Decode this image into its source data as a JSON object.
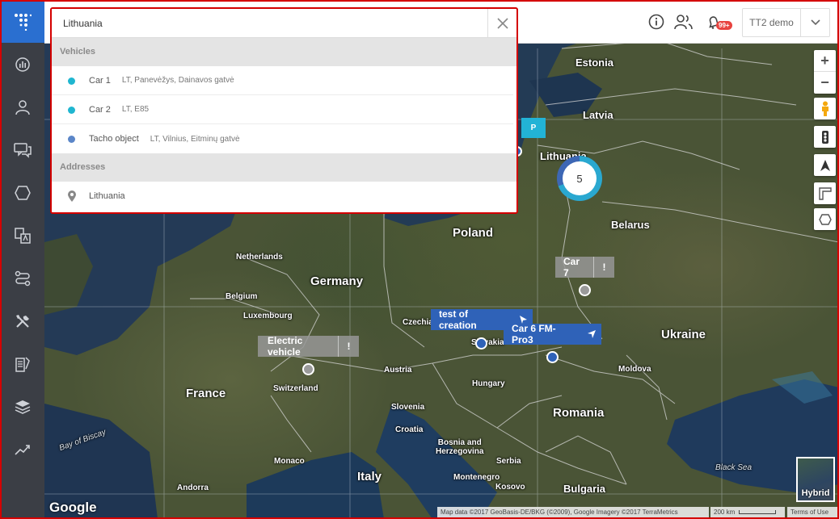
{
  "header": {
    "account_name": "TT2 demo",
    "notification_badge": "99+",
    "icons": [
      "info-icon",
      "users-icon",
      "notifications-icon"
    ]
  },
  "sidebar": {
    "items": [
      "logo",
      "dashboard-icon",
      "user-icon",
      "messages-icon",
      "geozones-icon",
      "reports-icon",
      "routes-icon",
      "tools-icon",
      "documents-icon",
      "layers-icon",
      "trends-icon"
    ]
  },
  "search": {
    "value": "Lithuania",
    "vehicles_header": "Vehicles",
    "vehicles": [
      {
        "name": "Car 1",
        "address": "LT, Panevėžys, Dainavos gatvė",
        "color": "#1fb6d0"
      },
      {
        "name": "Car 2",
        "address": "LT, E85",
        "color": "#1fb6d0"
      },
      {
        "name": "Tacho object",
        "address": "LT, Vilnius, Eitminų gatvė",
        "color": "#5b86c8"
      }
    ],
    "addresses_header": "Addresses",
    "addresses": [
      {
        "name": "Lithuania"
      }
    ]
  },
  "map": {
    "labels": {
      "estonia": "Estonia",
      "latvia": "Latvia",
      "lithuania": "Lithuania",
      "belarus": "Belarus",
      "poland": "Poland",
      "netherlands": "Netherlands",
      "germany": "Germany",
      "belgium": "Belgium",
      "luxembourg": "Luxembourg",
      "czechia": "Czechia",
      "slovakia": "Slovakia",
      "ukraine": "Ukraine",
      "austria": "Austria",
      "hungary": "Hungary",
      "moldova": "Moldova",
      "france": "France",
      "switzerland": "Switzerland",
      "slovenia": "Slovenia",
      "croatia": "Croatia",
      "romania": "Romania",
      "bosnia": "Bosnia and\nHerzegovina",
      "serbia": "Serbia",
      "monaco": "Monaco",
      "italy": "Italy",
      "montenegro": "Montenegro",
      "kosovo": "Kosovo",
      "bulgaria": "Bulgaria",
      "andorra": "Andorra",
      "bay_of_biscay": "Bay of Biscay",
      "black_sea": "Black Sea"
    },
    "cluster_count": "5",
    "parking_tag": "P",
    "vehicles": [
      {
        "label": "Car 7",
        "style": "gray"
      },
      {
        "label": "test of creation",
        "style": "blue"
      },
      {
        "label": "Car 6 FM-Pro3",
        "style": "blue"
      },
      {
        "label": "Electric vehicle",
        "style": "gray"
      }
    ],
    "alert_symbol": "!",
    "zoom_in": "+",
    "zoom_out": "−",
    "map_type": "Hybrid",
    "google_logo": "Google",
    "attribution": "Map data ©2017 GeoBasis-DE/BKG (©2009), Google Imagery ©2017 TerraMetrics",
    "scale": "200 km",
    "terms": "Terms of Use"
  },
  "colors": {
    "sidebar": "#3b3e45",
    "logo_bg": "#2a6fd0",
    "highlight_border": "#d40000",
    "vehicle_blue": "#2f62b8",
    "cluster_cyan": "#2aa8d0"
  }
}
